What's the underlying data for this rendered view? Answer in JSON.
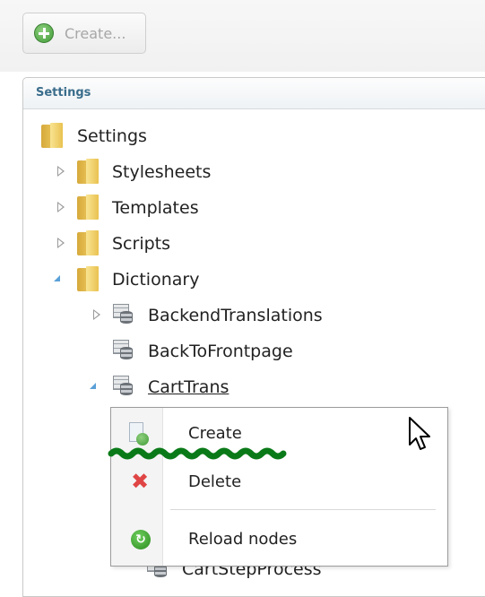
{
  "toolbar": {
    "create_label": "Create..."
  },
  "panel": {
    "title": "Settings"
  },
  "tree": {
    "root": {
      "label": "Settings",
      "icon": "folder-icon"
    },
    "items": [
      {
        "label": "Stylesheets",
        "icon": "folder-icon",
        "expander": "collapsed"
      },
      {
        "label": "Templates",
        "icon": "folder-icon",
        "expander": "collapsed"
      },
      {
        "label": "Scripts",
        "icon": "folder-icon",
        "expander": "collapsed"
      },
      {
        "label": "Dictionary",
        "icon": "folder-icon",
        "expander": "expanded"
      }
    ],
    "dictionary_children": [
      {
        "label": "BackendTranslations",
        "icon": "dictionary-icon",
        "expander": "collapsed"
      },
      {
        "label": "BackToFrontpage",
        "icon": "dictionary-icon",
        "expander": "none"
      },
      {
        "label": "CartTrans",
        "icon": "dictionary-icon",
        "expander": "expanded",
        "selected": true
      }
    ],
    "partially_hidden": {
      "label": "CartStepProcess"
    }
  },
  "context_menu": {
    "items": [
      {
        "label": "Create",
        "icon": "create-document-icon"
      },
      {
        "label": "Delete",
        "icon": "delete-icon"
      },
      {
        "label": "Reload nodes",
        "icon": "reload-icon"
      }
    ]
  },
  "colors": {
    "panel_title": "#3a6d8c",
    "annotation_squiggle": "#0a7a18",
    "expanded_arrow": "#5aa0d8"
  }
}
